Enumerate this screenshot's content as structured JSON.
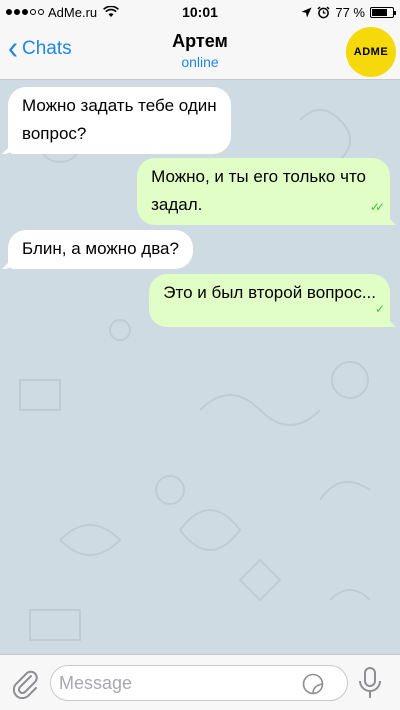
{
  "status_bar": {
    "carrier": "AdMe.ru",
    "time": "10:01",
    "battery": "77 %",
    "battery_level": 0.77,
    "signal_bars_filled": 3,
    "signal_bars_total": 5
  },
  "nav": {
    "back_label": "Chats",
    "contact_name": "Артем",
    "contact_status": "online",
    "avatar_text": "ADME"
  },
  "messages": [
    {
      "direction": "in",
      "lines": [
        "Можно задать тебе один",
        "вопрос?"
      ]
    },
    {
      "direction": "out",
      "lines": [
        "Можно, и ты его только что",
        "задал."
      ],
      "status": "read"
    },
    {
      "direction": "in",
      "lines": [
        "Блин, а можно два?"
      ]
    },
    {
      "direction": "out",
      "lines": [
        "Это и был второй вопрос..."
      ],
      "status": "sent"
    }
  ],
  "input": {
    "placeholder": "Message"
  },
  "colors": {
    "accent": "#1f86e4",
    "chat_background": "#cfdbe3",
    "incoming_bubble": "#ffffff",
    "outgoing_bubble": "#e1fec6",
    "check_color": "#3ec33e",
    "avatar_bg": "#f5d90a"
  }
}
